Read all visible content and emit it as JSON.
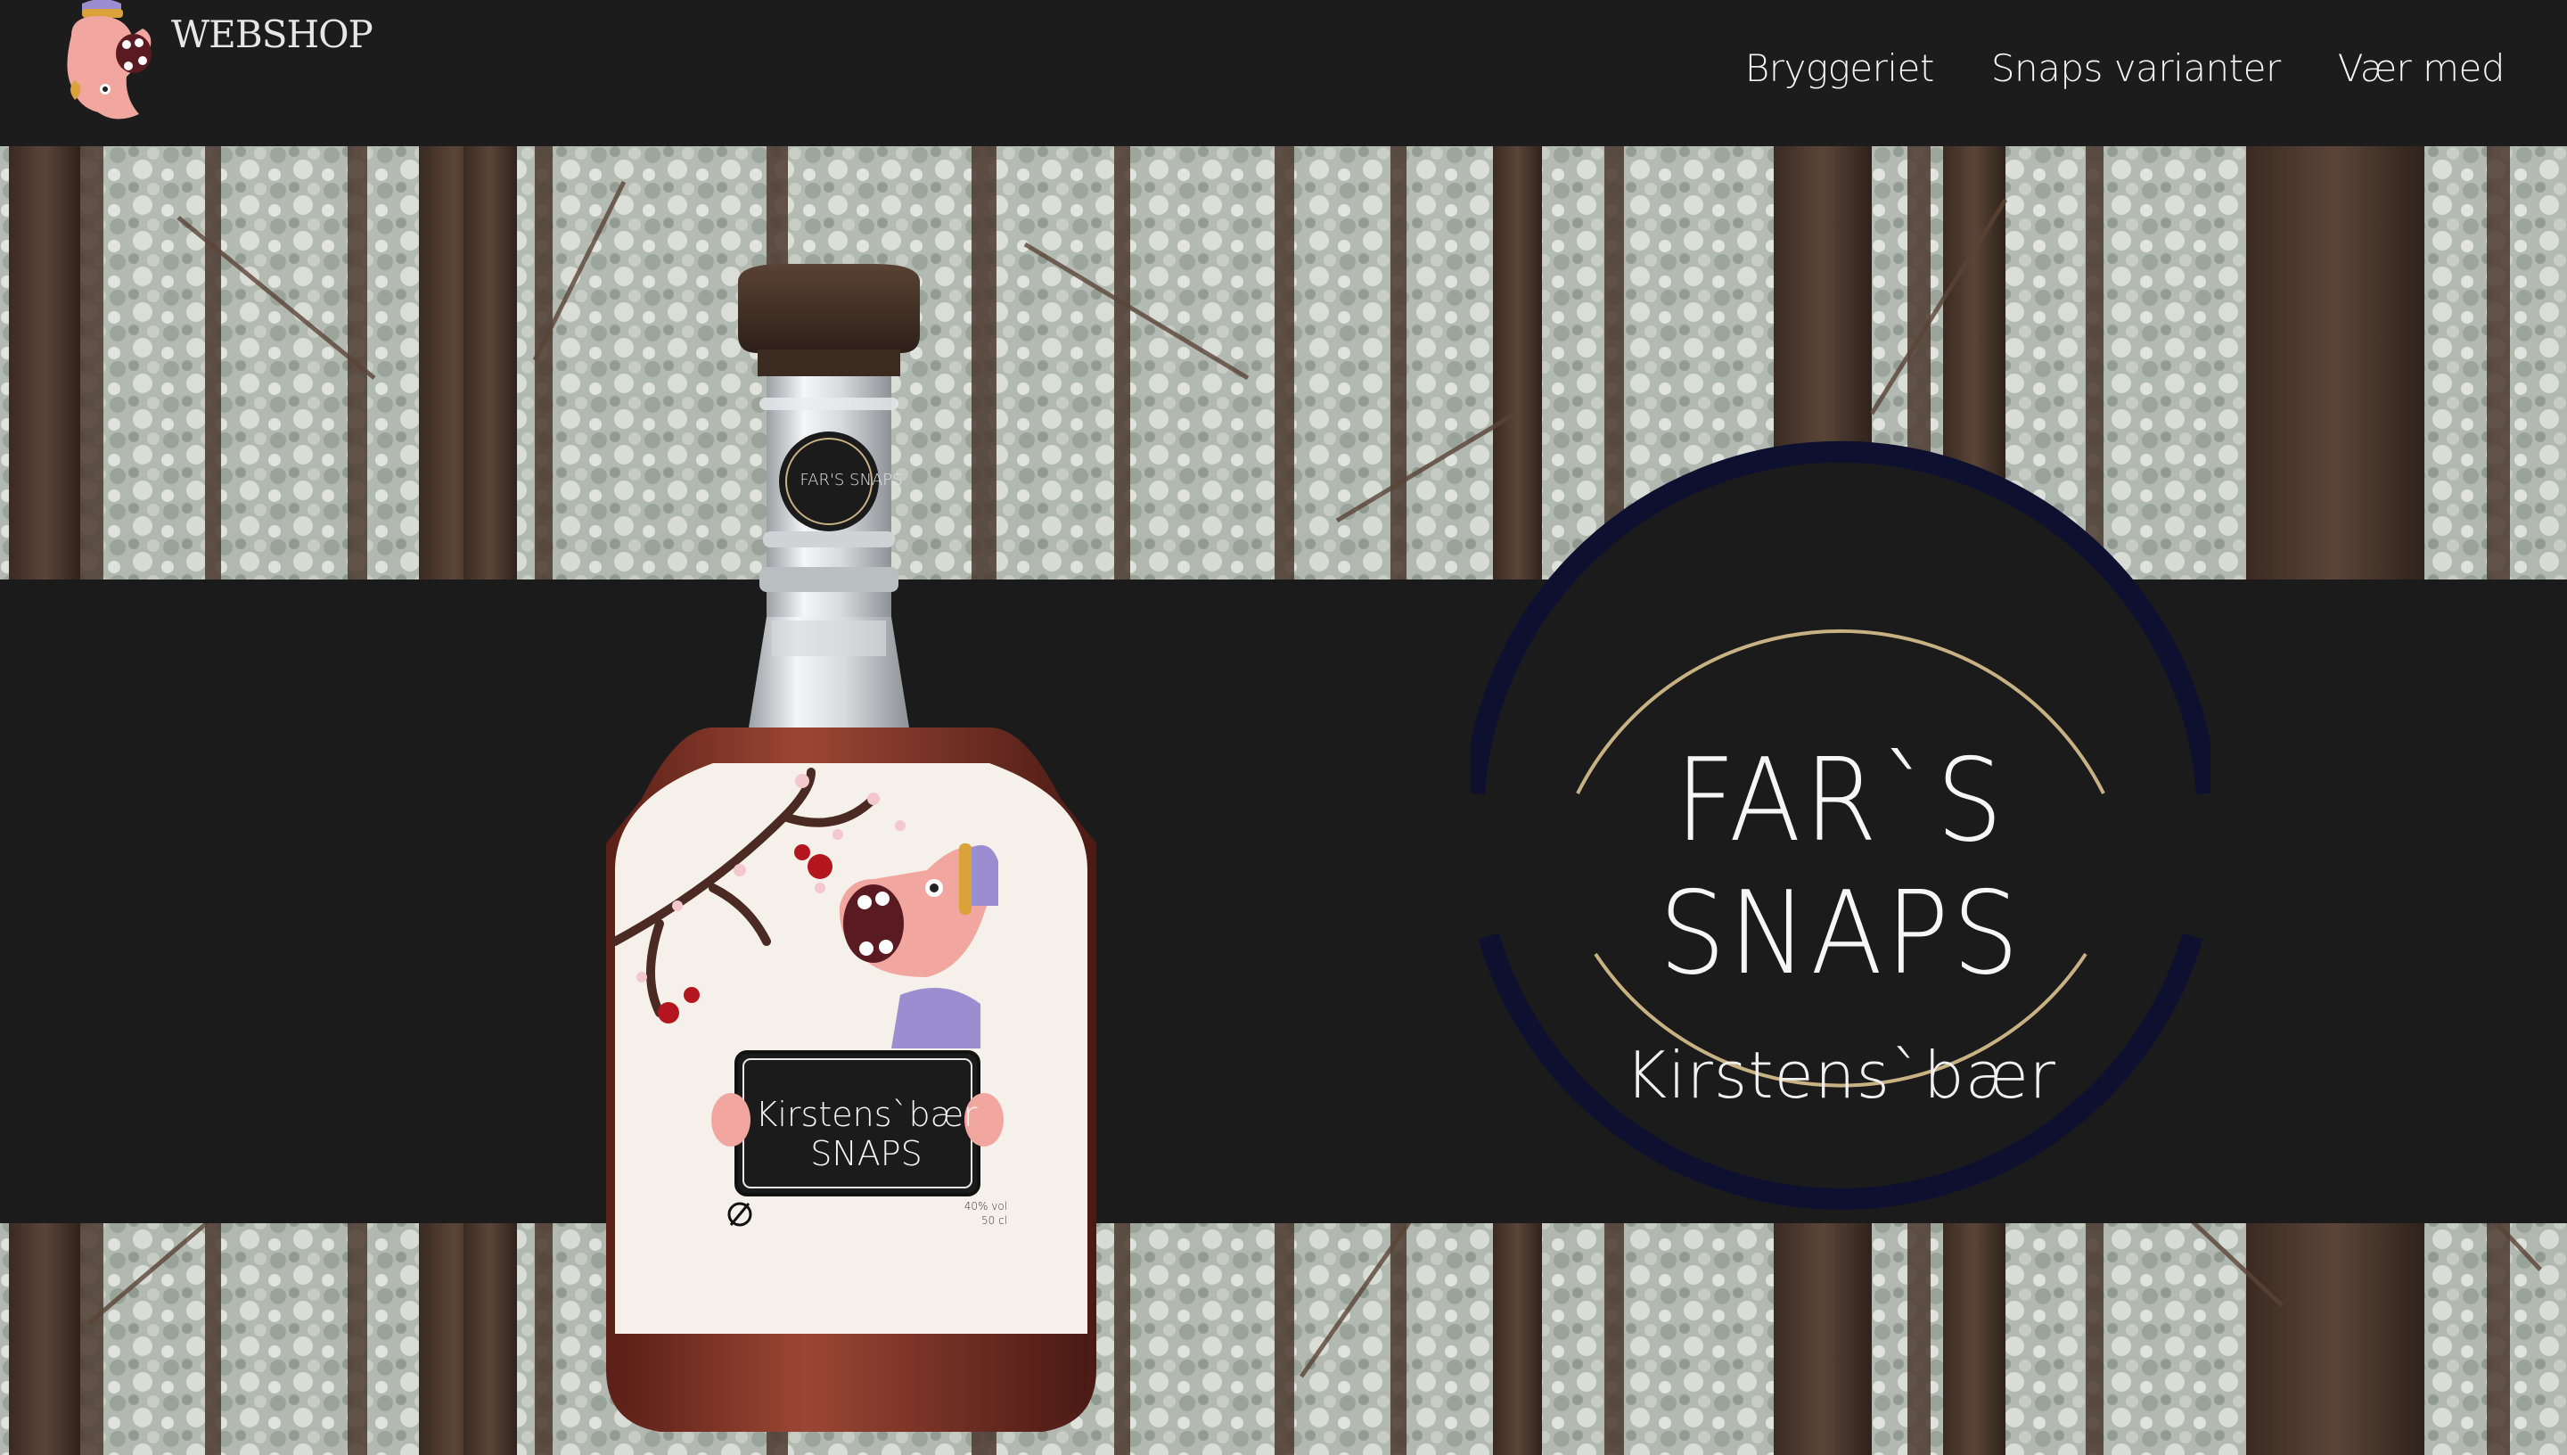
{
  "header": {
    "logo_text": "WEBSHOP",
    "nav": [
      {
        "label": "Bryggeriet"
      },
      {
        "label": "Snaps varianter"
      },
      {
        "label": "Vær med"
      }
    ]
  },
  "hero": {
    "brand_title": "FAR`S SNAPS",
    "brand_subtitle": "Kirstens`bær",
    "bottle": {
      "neck_label": "FAR'S SNAPS",
      "plaque_line1": "Kirstens`bær",
      "plaque_line2": "SNAPS",
      "abv": "40% vol",
      "volume": "50 cl"
    }
  },
  "colors": {
    "background": "#1b1b1c",
    "emblem_ring": "#0e1030",
    "emblem_gold": "#c8b283",
    "character_pink": "#f1a7a0",
    "character_purple": "#9a8ed0"
  }
}
